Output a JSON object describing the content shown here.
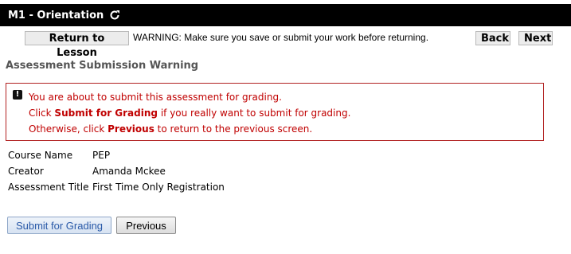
{
  "titlebar": {
    "title": "M1 - Orientation",
    "refresh_icon": "refresh-icon"
  },
  "nav": {
    "return_label": "Return to Lesson",
    "warning_text": "WARNING: Make sure you save or submit your work before returning.",
    "back_label": "Back",
    "next_label": "Next"
  },
  "page": {
    "section_title": "Assessment Submission Warning"
  },
  "alert": {
    "icon": "exclamation-icon",
    "line1": "You are about to submit this assessment for grading.",
    "line2_pre": "Click ",
    "line2_bold": "Submit for Grading",
    "line2_post": " if you really want to submit for grading.",
    "line3_pre": "Otherwise, click ",
    "line3_bold": "Previous",
    "line3_post": " to return to the previous screen.",
    "color": "#c00000"
  },
  "details": [
    {
      "label": "Course Name",
      "value": "PEP"
    },
    {
      "label": "Creator",
      "value": "Amanda Mckee"
    },
    {
      "label": "Assessment Title",
      "value": "First Time Only Registration"
    }
  ],
  "actions": {
    "submit_label": "Submit for Grading",
    "previous_label": "Previous"
  }
}
